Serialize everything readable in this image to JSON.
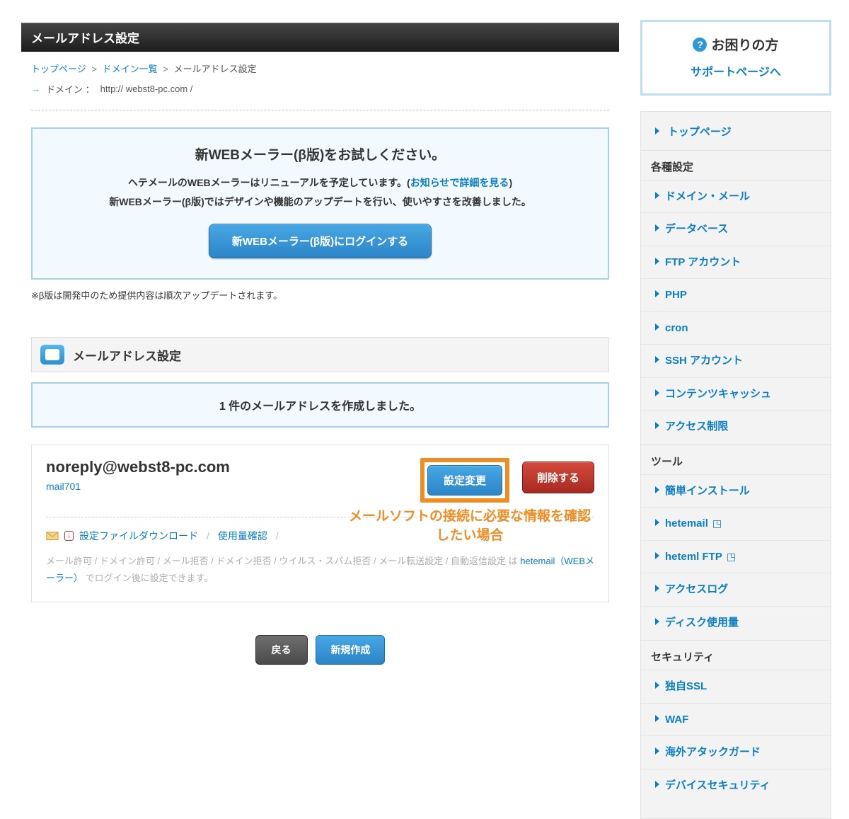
{
  "header": {
    "title": "メールアドレス設定"
  },
  "breadcrumb": {
    "top": "トップページ",
    "domain_list": "ドメイン一覧",
    "current": "メールアドレス設定"
  },
  "domain": {
    "label": "ドメイン  ：",
    "value": "http:// webst8-pc.com /"
  },
  "info_panel": {
    "title": "新WEBメーラー(β版)をお試しください。",
    "line1_a": "ヘテメールのWEBメーラーはリニューアルを予定しています。(",
    "line1_link": "お知らせで詳細を見る",
    "line1_b": ")",
    "line2": "新WEBメーラー(β版)ではデザインや機能のアップデートを行い、使いやすさを改善しました。",
    "button": "新WEBメーラー(β版)にログインする",
    "note": "※β版は開発中のため提供内容は順次アップデートされます。"
  },
  "section": {
    "title": "メールアドレス設定",
    "notice": "1 件のメールアドレスを作成しました。"
  },
  "mail": {
    "address": "noreply@webst8-pc.com",
    "account": "mail701",
    "change_btn": "設定変更",
    "delete_btn": "削除する",
    "orange_note": "メールソフトの接続に必要な情報を確認したい場合",
    "dl_link": "設定ファイルダウンロード",
    "usage_link": "使用量確認",
    "foot_pre": "メール許可 / ドメイン許可 / メール拒否 / ドメイン拒否 / ウイルス・スパム拒否 / メール転送設定 / 自動返信設定 は ",
    "foot_link": "hetemail（WEBメーラー）",
    "foot_post": " でログイン後に設定できます。"
  },
  "bottom": {
    "back": "戻る",
    "new": "新規作成"
  },
  "sidebar": {
    "help": {
      "title": "お困りの方",
      "link": "サポートページへ"
    },
    "top_link": "トップページ",
    "sections": {
      "settings": {
        "title": "各種設定",
        "items": [
          "ドメイン・メール",
          "データベース",
          "FTP アカウント",
          "PHP",
          "cron",
          "SSH アカウント",
          "コンテンツキャッシュ",
          "アクセス制限"
        ]
      },
      "tools": {
        "title": "ツール",
        "items": [
          "簡単インストール",
          "hetemail",
          "heteml FTP",
          "アクセスログ",
          "ディスク使用量"
        ],
        "ext_flags": [
          false,
          true,
          true,
          false,
          false
        ]
      },
      "security": {
        "title": "セキュリティ",
        "items": [
          "独自SSL",
          "WAF",
          "海外アタックガード",
          "デバイスセキュリティ"
        ]
      }
    }
  }
}
